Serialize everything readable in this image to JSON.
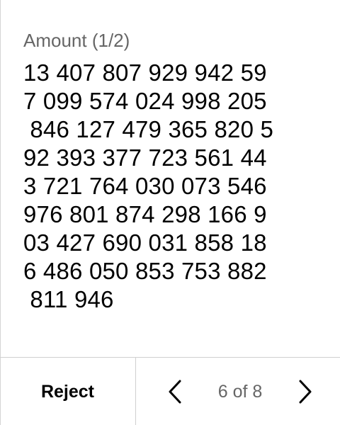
{
  "field": {
    "label": "Amount (1/2)",
    "value_lines": [
      "13 407 807 929 942 59",
      "7 099 574 024 998 205",
      " 846 127 479 365 820 5",
      "92 393 377 723 561 44",
      "3 721 764 030 073 546",
      "976 801 874 298 166 9",
      "03 427 690 031 858 18",
      "6 486 050 853 753 882",
      " 811 946"
    ]
  },
  "footer": {
    "reject_label": "Reject",
    "page_indicator": "6 of 8",
    "prev_icon": "chevron-left-icon",
    "next_icon": "chevron-right-icon"
  },
  "colors": {
    "label_gray": "#666666",
    "divider": "#cfcfcf",
    "text": "#000000"
  }
}
